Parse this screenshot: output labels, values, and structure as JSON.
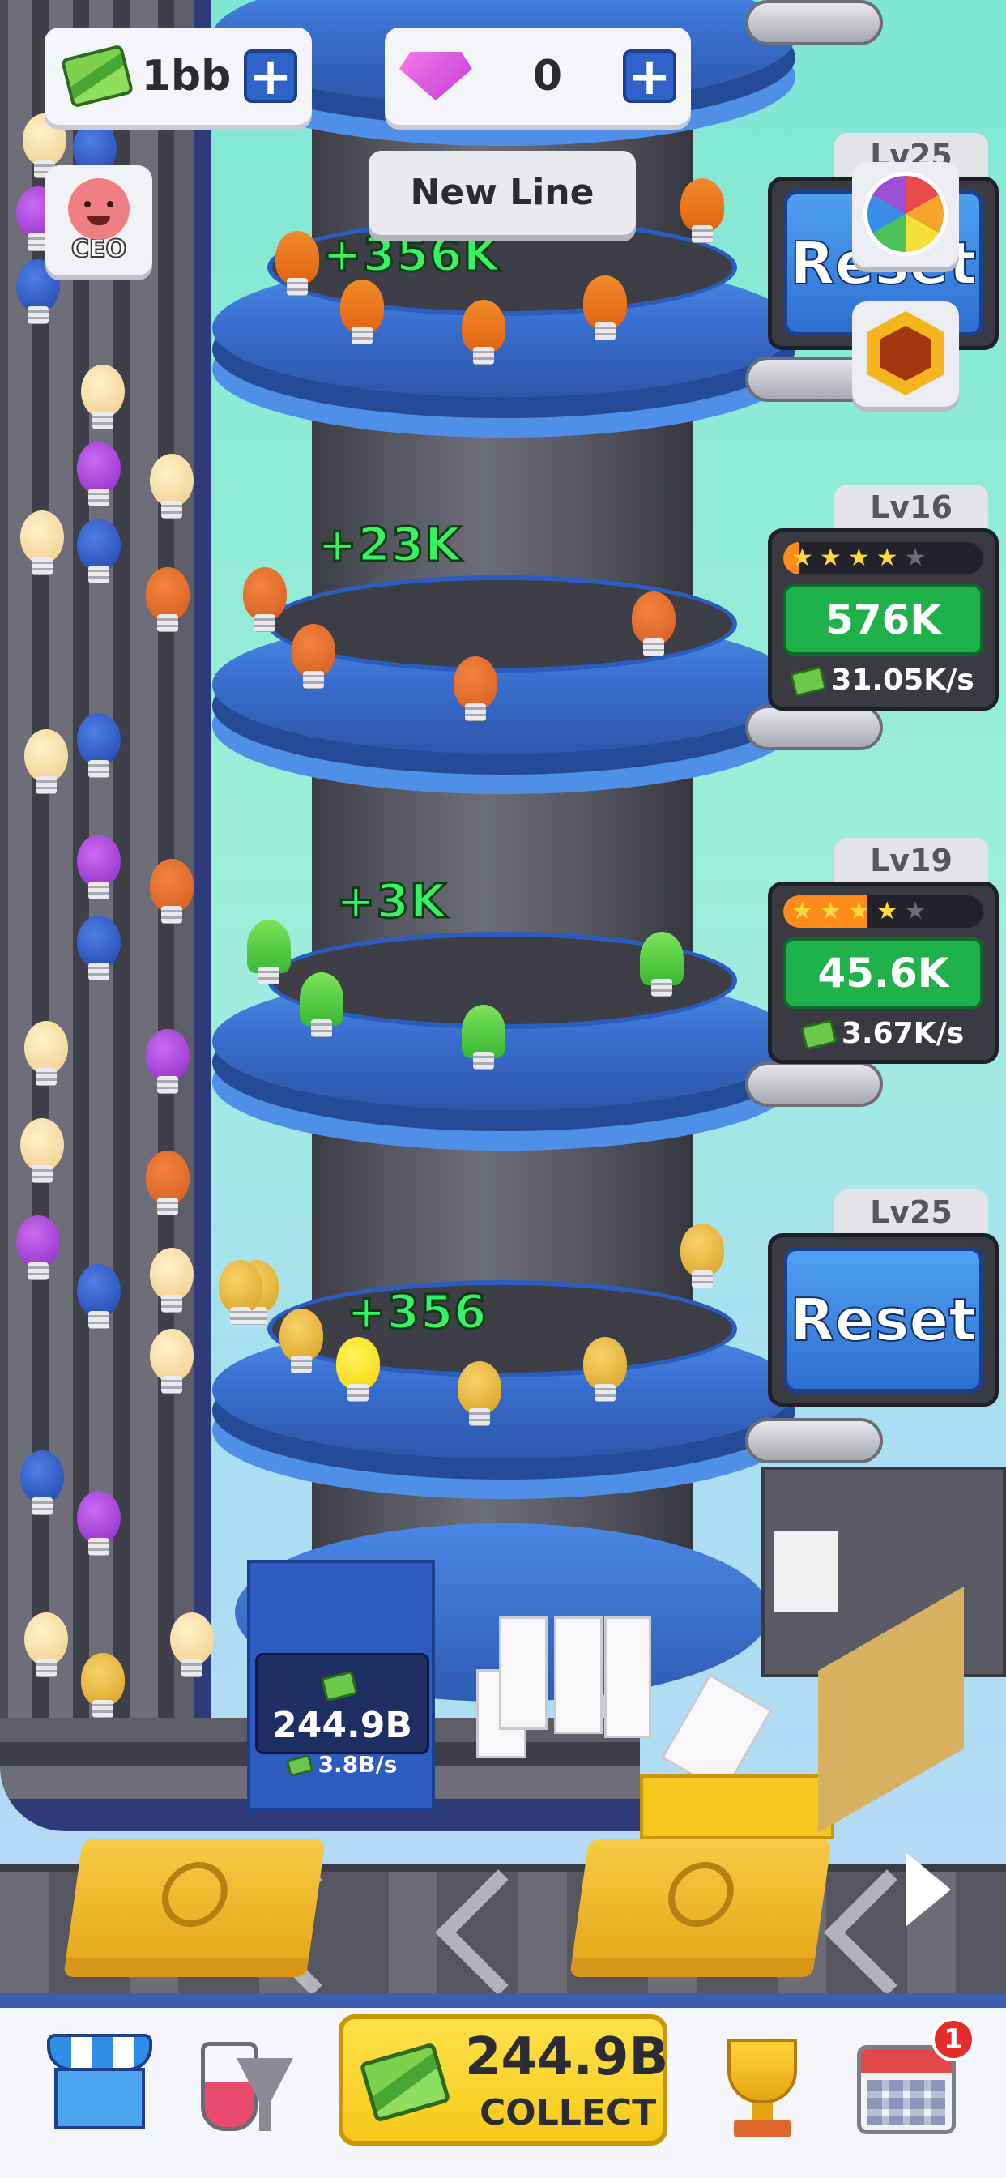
{
  "currency": {
    "cash": "1bb",
    "gems": "0",
    "add_symbol": "+"
  },
  "ceo_label": "CEO",
  "new_line_label": "New Line",
  "floors": [
    {
      "earning": "+356K",
      "product": "carrot"
    },
    {
      "earning": "+23K",
      "product": "pumpkin"
    },
    {
      "earning": "+3K",
      "product": "tree"
    },
    {
      "earning": "+356",
      "product": "golden-bulb"
    }
  ],
  "panels": [
    {
      "level": "Lv25",
      "button": "Reset",
      "type": "reset"
    },
    {
      "level": "Lv16",
      "stars_filled": 4,
      "stars_total": 5,
      "progress": 0.08,
      "upgrade_cost": "576K",
      "rate": "31.05K/s",
      "type": "upgrade"
    },
    {
      "level": "Lv19",
      "stars_filled": 4,
      "stars_total": 5,
      "progress": 0.42,
      "upgrade_cost": "45.6K",
      "rate": "3.67K/s",
      "type": "upgrade"
    },
    {
      "level": "Lv25",
      "button": "Reset",
      "type": "reset"
    }
  ],
  "money_box": {
    "amount": "244.9B",
    "rate": "3.8B/s"
  },
  "collect": {
    "amount": "244.9B",
    "label": "COLLECT"
  },
  "nav": {
    "calendar_badge": "1"
  },
  "icons": {
    "cash": "cash-stack-icon",
    "gem": "gem-icon",
    "shop": "shop-icon",
    "lab": "lab-icon",
    "trophy": "trophy-icon",
    "calendar": "calendar-icon",
    "wheel": "lucky-wheel-icon",
    "hex": "hexagon-boost-icon"
  },
  "colors": {
    "accent_blue": "#2f63c9",
    "upgrade_green": "#1fb14a",
    "earning_green": "#37f264",
    "collect_yellow": "#f6c919",
    "star_on": "#ffd83b"
  }
}
